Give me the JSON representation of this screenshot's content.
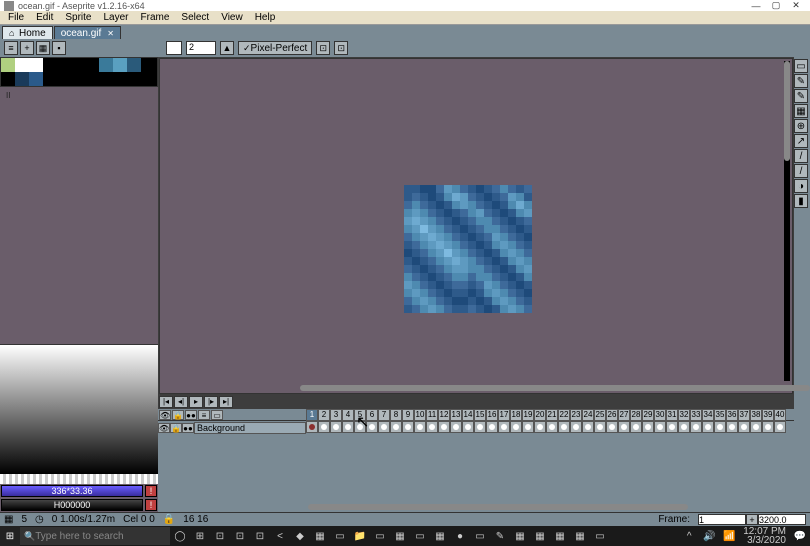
{
  "window": {
    "title": "ocean.gif - Aseprite v1.2.16-x64"
  },
  "menu": [
    "File",
    "Edit",
    "Sprite",
    "Layer",
    "Frame",
    "Select",
    "View",
    "Help"
  ],
  "tabs": {
    "home": "Home",
    "active": "ocean.gif"
  },
  "toolbar": {
    "brush_size": "2",
    "pixel_perfect": "Pixel-Perfect"
  },
  "palette": [
    "#b0d080",
    "#ffffff",
    "#ffffff",
    "#000000",
    "#000000",
    "#000000",
    "#000000",
    "#3a7a9a",
    "#5aa0c0",
    "#2a5a7a",
    "#000000",
    "#000000",
    "#1a3a5a",
    "#2a5a8a",
    "#000000",
    "#000000",
    "#000000",
    "#000000",
    "#000000",
    "#000000",
    "#000000",
    "#000000"
  ],
  "coords": {
    "a": "336*33.36",
    "b": "H000000"
  },
  "frames": {
    "total": 40,
    "current": 1
  },
  "layer": {
    "name": "Background"
  },
  "status": {
    "info1": "5",
    "info2": "0 1.00s/1.27m",
    "info3": "Cel  0 0",
    "info4": "16 16",
    "frame_label": "Frame:",
    "frame_val": "1",
    "zoom": "3200.0"
  },
  "taskbar": {
    "search": "Type here to search",
    "time": "12:07 PM",
    "date": "3/3/2020"
  },
  "sprite_cells": [
    "#2e5a8a",
    "#2e5a8a",
    "#1e4a7a",
    "#1e4a7a",
    "#3e6a9a",
    "#5e9ac0",
    "#4e8ab0",
    "#3e6a9a",
    "#2e5a8a",
    "#1e4a7a",
    "#2e5a8a",
    "#3e6a9a",
    "#4e8ab0",
    "#3e6a9a",
    "#2e5a8a",
    "#3e6a9a",
    "#2e5a8a",
    "#3e6a9a",
    "#2e5a8a",
    "#1e4a7a",
    "#2e5a8a",
    "#4e8ab0",
    "#6eaad0",
    "#5e9ac0",
    "#3e6a9a",
    "#2e5a8a",
    "#1e4a7a",
    "#2e5a8a",
    "#3e6a9a",
    "#5e9ac0",
    "#4e8ab0",
    "#2e5a8a",
    "#3e6a9a",
    "#4e8ab0",
    "#3e6a9a",
    "#2e5a8a",
    "#1e4a7a",
    "#2e5a8a",
    "#4e8ab0",
    "#5e9ac0",
    "#4e8ab0",
    "#3e6a9a",
    "#2e5a8a",
    "#1e4a7a",
    "#2e5a8a",
    "#4e8ab0",
    "#6eaad0",
    "#4e8ab0",
    "#4e8ab0",
    "#5e9ac0",
    "#4e8ab0",
    "#3e6a9a",
    "#2e5a8a",
    "#1e4a7a",
    "#2e5a8a",
    "#3e6a9a",
    "#4e8ab0",
    "#5e9ac0",
    "#3e6a9a",
    "#2e5a8a",
    "#1e4a7a",
    "#2e5a8a",
    "#4e8ab0",
    "#5e9ac0",
    "#5e9ac0",
    "#6eaad0",
    "#5e9ac0",
    "#4e8ab0",
    "#3e6a9a",
    "#2e5a8a",
    "#1e4a7a",
    "#2e5a8a",
    "#3e6a9a",
    "#4e8ab0",
    "#4e8ab0",
    "#3e6a9a",
    "#2e5a8a",
    "#1e4a7a",
    "#2e5a8a",
    "#3e6a9a",
    "#4e8ab0",
    "#5e9ac0",
    "#7ebae0",
    "#5e9ac0",
    "#4e8ab0",
    "#3e6a9a",
    "#2e5a8a",
    "#1e4a7a",
    "#2e5a8a",
    "#3e6a9a",
    "#4e8ab0",
    "#4e8ab0",
    "#3e6a9a",
    "#2e5a8a",
    "#1e4a7a",
    "#2e5a8a",
    "#3e6a9a",
    "#4e8ab0",
    "#5e9ac0",
    "#6eaad0",
    "#5e9ac0",
    "#4e8ab0",
    "#3e6a9a",
    "#2e5a8a",
    "#1e4a7a",
    "#2e5a8a",
    "#3e6a9a",
    "#5e9ac0",
    "#4e8ab0",
    "#3e6a9a",
    "#2e5a8a",
    "#1e4a7a",
    "#2e5a8a",
    "#3e6a9a",
    "#4e8ab0",
    "#5e9ac0",
    "#6eaad0",
    "#5e9ac0",
    "#4e8ab0",
    "#3e6a9a",
    "#2e5a8a",
    "#1e4a7a",
    "#2e5a8a",
    "#4e8ab0",
    "#5e9ac0",
    "#4e8ab0",
    "#3e6a9a",
    "#2e5a8a",
    "#1e4a7a",
    "#2e5a8a",
    "#3e6a9a",
    "#4e8ab0",
    "#5e9ac0",
    "#7ebae0",
    "#5e9ac0",
    "#4e8ab0",
    "#3e6a9a",
    "#2e5a8a",
    "#1e4a7a",
    "#2e5a8a",
    "#4e8ab0",
    "#5e9ac0",
    "#4e8ab0",
    "#3e6a9a",
    "#2e5a8a",
    "#1e4a7a",
    "#2e5a8a",
    "#3e6a9a",
    "#4e8ab0",
    "#5e9ac0",
    "#6eaad0",
    "#5e9ac0",
    "#4e8ab0",
    "#3e6a9a",
    "#2e5a8a",
    "#1e4a7a",
    "#2e5a8a",
    "#4e8ab0",
    "#5e9ac0",
    "#4e8ab0",
    "#3e6a9a",
    "#2e5a8a",
    "#1e4a7a",
    "#2e5a8a",
    "#3e6a9a",
    "#4e8ab0",
    "#5e9ac0",
    "#5e9ac0",
    "#4e8ab0",
    "#4e8ab0",
    "#3e6a9a",
    "#2e5a8a",
    "#1e4a7a",
    "#2e5a8a",
    "#4e8ab0",
    "#5e9ac0",
    "#4e8ab0",
    "#3e6a9a",
    "#2e5a8a",
    "#1e4a7a",
    "#2e5a8a",
    "#3e6a9a",
    "#4e8ab0",
    "#4e8ab0",
    "#3e6a9a",
    "#4e8ab0",
    "#4e8ab0",
    "#3e6a9a",
    "#2e5a8a",
    "#1e4a7a",
    "#2e5a8a",
    "#4e8ab0",
    "#5e9ac0",
    "#4e8ab0",
    "#3e6a9a",
    "#2e5a8a",
    "#1e4a7a",
    "#2e5a8a",
    "#3e6a9a",
    "#3e6a9a",
    "#2e5a8a",
    "#3e6a9a",
    "#5e9ac0",
    "#4e8ab0",
    "#3e6a9a",
    "#2e5a8a",
    "#1e4a7a",
    "#2e5a8a",
    "#4e8ab0",
    "#5e9ac0",
    "#4e8ab0",
    "#3e6a9a",
    "#2e5a8a",
    "#1e4a7a",
    "#2e5a8a",
    "#2e5a8a",
    "#1e4a7a",
    "#2e5a8a",
    "#4e8ab0",
    "#5e9ac0",
    "#4e8ab0",
    "#3e6a9a",
    "#2e5a8a",
    "#1e4a7a",
    "#3e6a9a",
    "#4e8ab0",
    "#5e9ac0",
    "#4e8ab0",
    "#3e6a9a",
    "#2e5a8a",
    "#1e4a7a",
    "#1e4a7a",
    "#2e5a8a",
    "#1e4a7a",
    "#2e5a8a",
    "#4e8ab0",
    "#5e9ac0",
    "#4e8ab0",
    "#3e6a9a",
    "#2e5a8a",
    "#2e5a8a",
    "#3e6a9a",
    "#4e8ab0",
    "#5e9ac0",
    "#4e8ab0",
    "#3e6a9a",
    "#2e5a8a",
    "#2e5a8a",
    "#3e6a9a",
    "#2e5a8a",
    "#1e4a7a",
    "#2e5a8a",
    "#4e8ab0",
    "#5e9ac0",
    "#4e8ab0",
    "#3e6a9a"
  ],
  "tools": [
    "▭",
    "✎",
    "✎",
    "▦",
    "⊕",
    "↗",
    "/",
    "/",
    "◑",
    "▮"
  ],
  "taskbar_icons": [
    "◯",
    "⊞",
    "⊡",
    "⊡",
    "⊡",
    "<",
    "◆",
    "▦",
    "▭",
    "📁",
    "▭",
    "▦",
    "▭",
    "▦",
    "●",
    "▭",
    "✎",
    "▦",
    "▦",
    "▦",
    "▦",
    "▭"
  ]
}
